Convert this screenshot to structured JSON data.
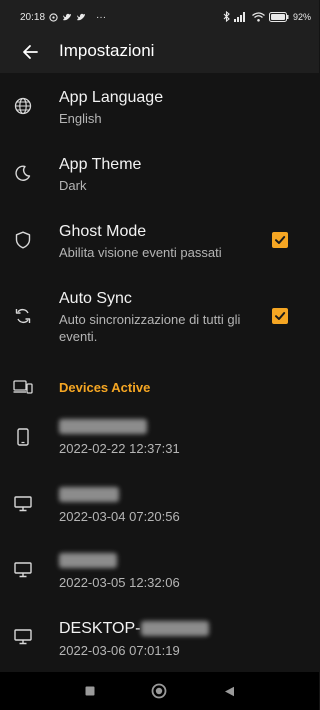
{
  "status_bar": {
    "time": "20:18",
    "left_icons": [
      "whatsapp-icon",
      "twitter-icon",
      "twitter-icon"
    ],
    "more": "···",
    "battery": "92"
  },
  "header": {
    "title": "Impostazioni"
  },
  "settings": [
    {
      "id": "language",
      "icon": "globe-icon",
      "title": "App Language",
      "subtitle": "English"
    },
    {
      "id": "theme",
      "icon": "moon-icon",
      "title": "App Theme",
      "subtitle": "Dark"
    },
    {
      "id": "ghost",
      "icon": "shield-icon",
      "title": "Ghost Mode",
      "subtitle": "Abilita visione eventi passati",
      "checked": true
    },
    {
      "id": "sync",
      "icon": "sync-icon",
      "title": "Auto Sync",
      "subtitle": "Auto sincronizzazione di tutti gli eventi.",
      "checked": true
    }
  ],
  "devices": {
    "section_title": "Devices Active",
    "items": [
      {
        "icon": "phone-icon",
        "name_prefix": "",
        "date": "2022-02-22 12:37:31"
      },
      {
        "icon": "desktop-icon",
        "name_prefix": "",
        "date": "2022-03-04 07:20:56"
      },
      {
        "icon": "desktop-icon",
        "name_prefix": "",
        "date": "2022-03-05 12:32:06"
      },
      {
        "icon": "desktop-icon",
        "name_prefix": "DESKTOP-",
        "date": "2022-03-06 07:01:19"
      }
    ]
  },
  "colors": {
    "accent": "#f5a623",
    "background": "#141414",
    "bar": "#1f1f1f"
  }
}
